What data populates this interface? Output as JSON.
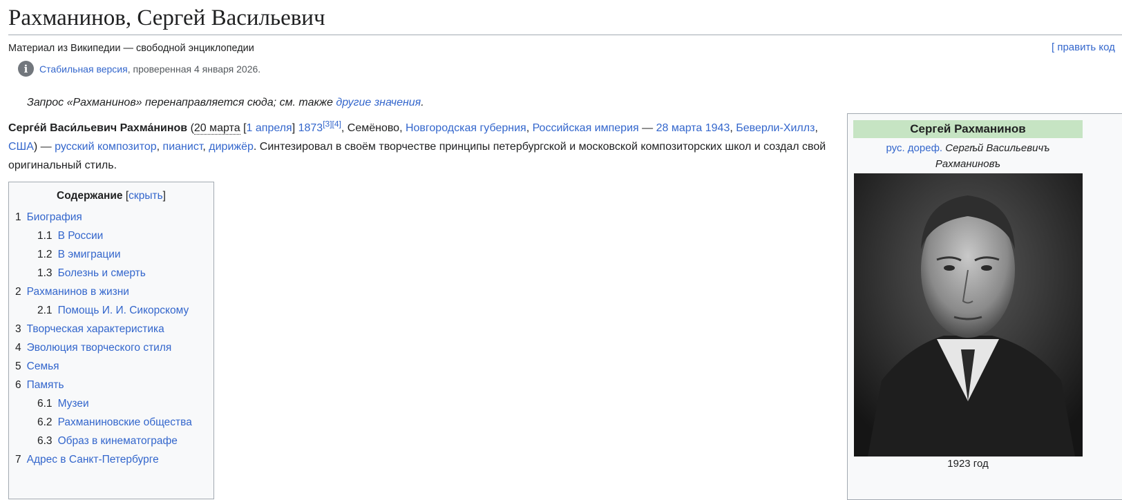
{
  "page": {
    "title": "Рахманинов, Сергей Васильевич",
    "tagline": "Материал из Википедии — свободной энциклопедии",
    "edit_link": "[ править код",
    "stable_link": "Стабильная версия",
    "stable_rest": ", проверенная 4 января 2026."
  },
  "hatnote": {
    "text": "Запрос «Рахманинов» перенаправляется сюда; см. также ",
    "link": "другие значения",
    "end": "."
  },
  "lead": {
    "name": "Серге́й Васи́льевич Рахма́нинов",
    "p1": " (",
    "date_old": "20 марта",
    "p2": " [",
    "date_new": "1 апреля",
    "p3": "] ",
    "year": "1873",
    "ref1": "[3]",
    "ref2": "[4]",
    "p4": ", Семёново, ",
    "place1": "Новгородская губерния",
    "p5": ", ",
    "place2": "Российская империя",
    "p6": " — ",
    "death_date": "28 марта 1943",
    "p7": ", ",
    "death_place": "Беверли-Хиллз",
    "p8": ", ",
    "country": "США",
    "p9": ") — ",
    "role1": "русский композитор",
    "p10": ", ",
    "role2": "пианист",
    "p11": ", ",
    "role3": "дирижёр",
    "p12": ". Синтезировал в своём творчестве принципы петербургской и московской композиторских школ и создал свой оригинальный стиль."
  },
  "toc": {
    "title": "Содержание",
    "hide": "скрыть",
    "items": [
      {
        "num": "1",
        "label": "Биография"
      },
      {
        "num": "1.1",
        "label": "В России"
      },
      {
        "num": "1.2",
        "label": "В эмиграции"
      },
      {
        "num": "1.3",
        "label": "Болезнь и смерть"
      },
      {
        "num": "2",
        "label": "Рахманинов в жизни"
      },
      {
        "num": "2.1",
        "label": "Помощь И. И. Сикорскому"
      },
      {
        "num": "3",
        "label": "Творческая характеристика"
      },
      {
        "num": "4",
        "label": "Эволюция творческого стиля"
      },
      {
        "num": "5",
        "label": "Семья"
      },
      {
        "num": "6",
        "label": "Память"
      },
      {
        "num": "6.1",
        "label": "Музеи"
      },
      {
        "num": "6.2",
        "label": "Рахманиновские общества"
      },
      {
        "num": "6.3",
        "label": "Образ в кинематографе"
      },
      {
        "num": "7",
        "label": "Адрес в Санкт-Петербурге"
      }
    ]
  },
  "infobox": {
    "name": "Сергей Рахманинов",
    "orig_link": "рус. дореф.",
    "orig_name": "Сергѣй Васильевичъ Рахманиновъ",
    "caption": "1923 год"
  }
}
